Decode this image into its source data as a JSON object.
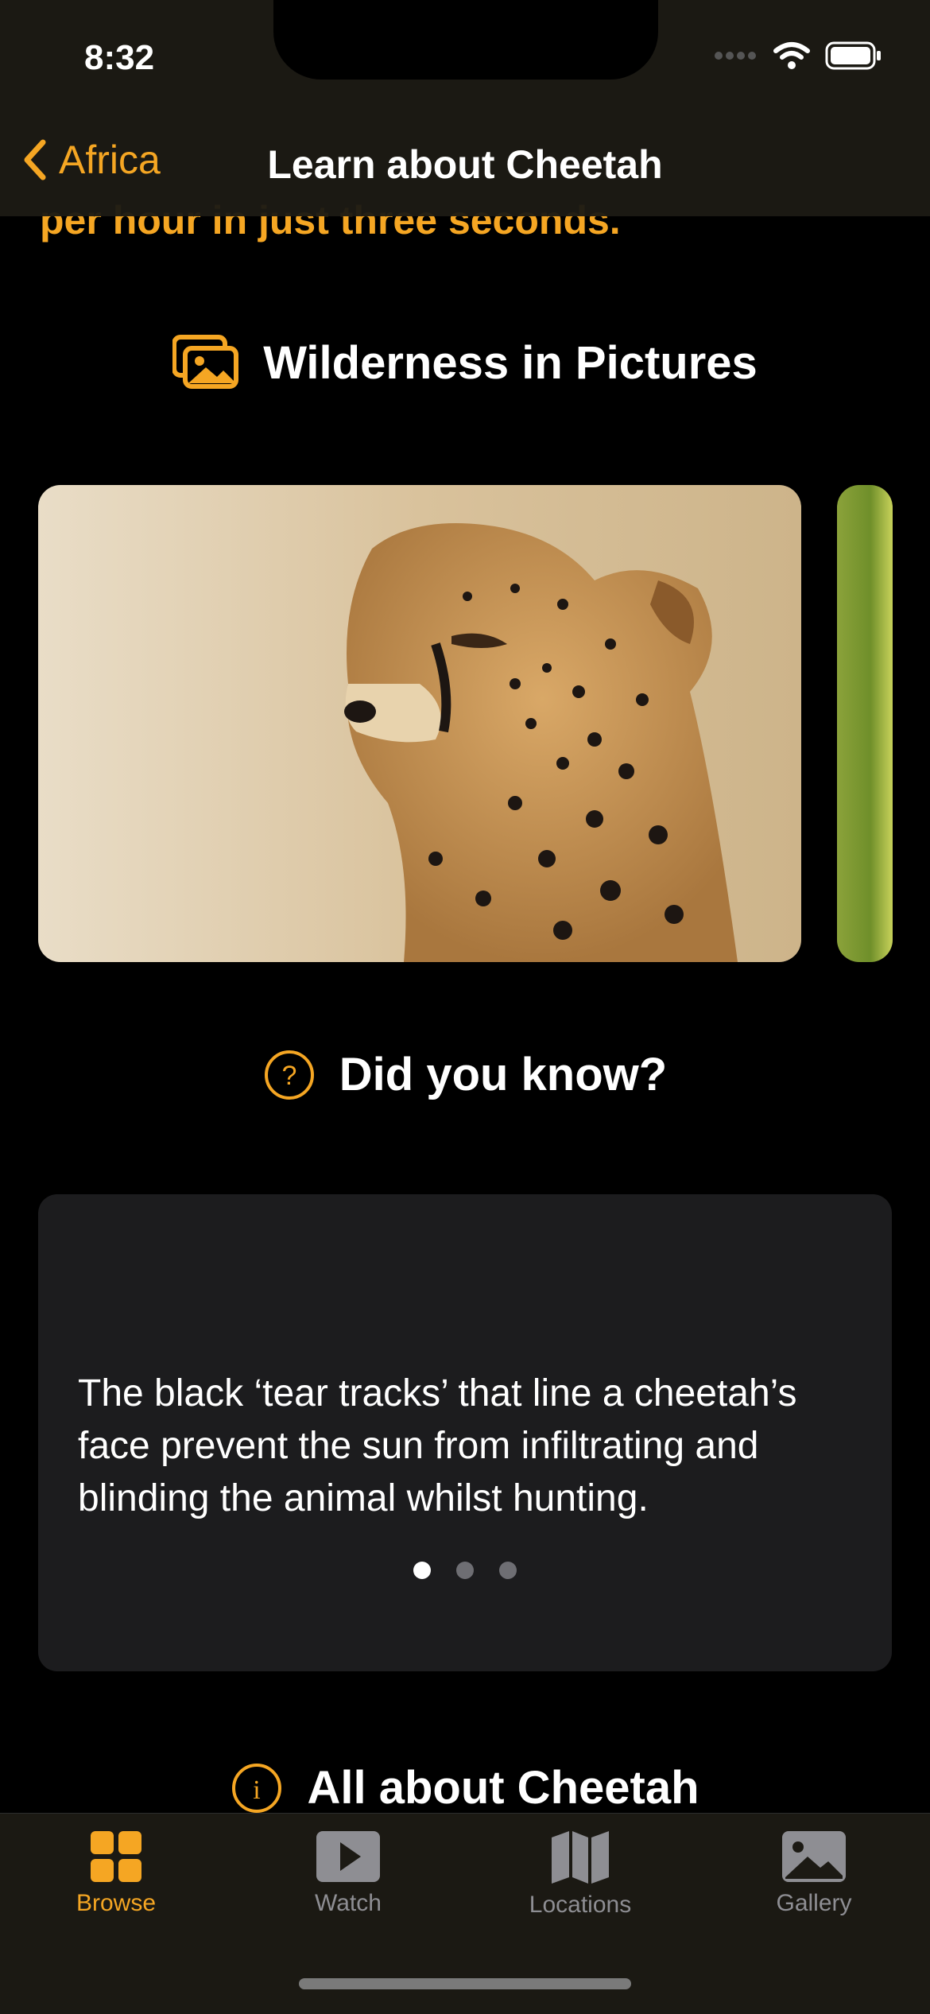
{
  "status_bar": {
    "time": "8:32"
  },
  "nav": {
    "back_label": "Africa",
    "title": "Learn about Cheetah"
  },
  "content": {
    "top_snippet": "per hour in just three seconds.",
    "pictures_section": {
      "title": "Wilderness in Pictures",
      "icon": "photo-stack-icon"
    },
    "did_you_know_section": {
      "title": "Did you know?",
      "icon": "question-circle-icon"
    },
    "fact_card": {
      "text": "The black ‘tear tracks’ that line a cheetah’s face prevent the sun from infiltrating and blinding the animal whilst hunting.",
      "page_count": 3,
      "current_page": 1
    },
    "all_about_section": {
      "title": "All about Cheetah",
      "icon": "info-circle-icon"
    }
  },
  "tab_bar": {
    "tabs": [
      {
        "label": "Browse",
        "icon": "grid-icon",
        "active": true
      },
      {
        "label": "Watch",
        "icon": "play-icon",
        "active": false
      },
      {
        "label": "Locations",
        "icon": "map-icon",
        "active": false
      },
      {
        "label": "Gallery",
        "icon": "photo-icon",
        "active": false
      }
    ]
  },
  "colors": {
    "accent": "#F5A623",
    "background": "#000000",
    "card": "#1c1c1e",
    "inactive": "#8e8e93"
  }
}
